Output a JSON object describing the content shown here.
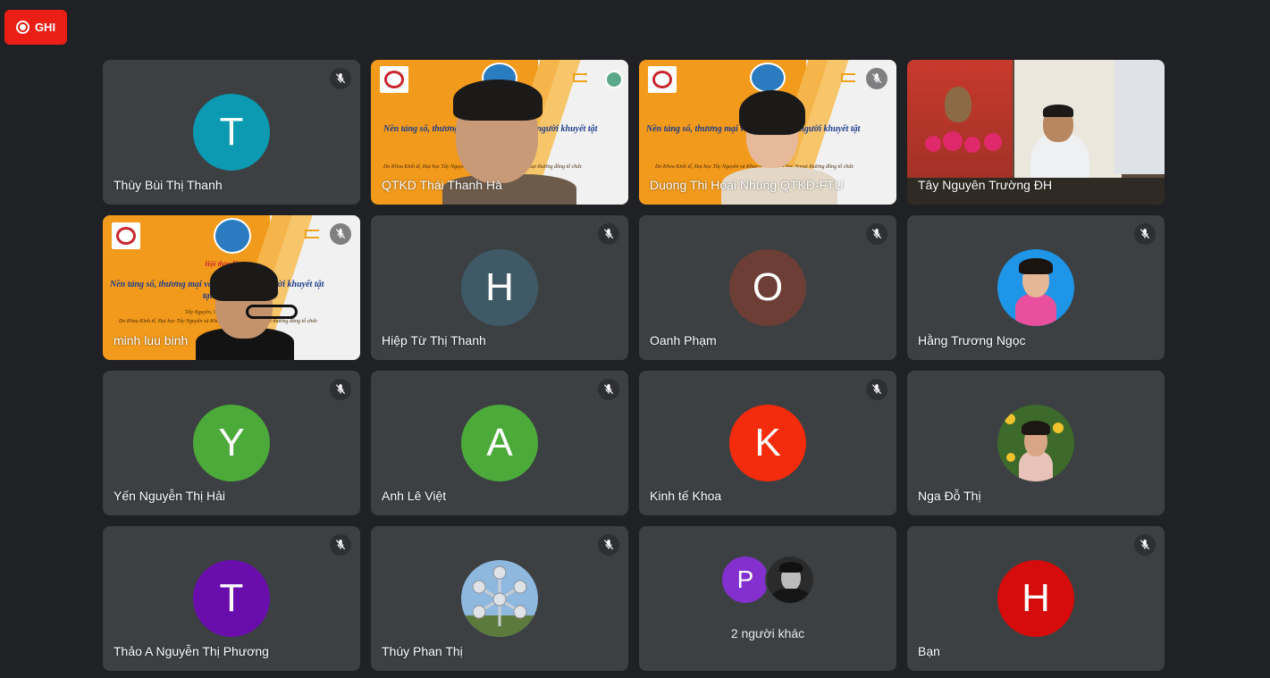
{
  "record": {
    "label": "GHI",
    "color": "#ea1e14",
    "icon": "record-icon"
  },
  "participants": [
    {
      "name": "Thùy Bùi Thị Thanh",
      "initial": "T",
      "color": "#0b9ab1",
      "muted": true
    },
    {
      "name": "QTKD Thái Thanh Hà",
      "video": "presentation",
      "muted": false
    },
    {
      "name": "Duong Thi Hoai Nhung QTKD-FTU",
      "video": "presentation",
      "muted": true
    },
    {
      "name": "Tây Nguyên Trường ĐH",
      "video": "room",
      "muted": false
    },
    {
      "name": "minh luu binh",
      "video": "presentation",
      "muted": true
    },
    {
      "name": "Hiệp Từ Thị Thanh",
      "initial": "H",
      "color": "#3f5a66",
      "muted": true
    },
    {
      "name": "Oanh Phạm",
      "initial": "O",
      "color": "#6d3e36",
      "muted": true
    },
    {
      "name": "Hằng Trương Ngọc",
      "photo": "portrait-blue",
      "muted": true
    },
    {
      "name": "Yến Nguyễn Thị Hải",
      "initial": "Y",
      "color": "#4caa3a",
      "muted": true
    },
    {
      "name": "Anh Lê Việt",
      "initial": "A",
      "color": "#4caa3a",
      "muted": true
    },
    {
      "name": "Kinh tế Khoa",
      "initial": "K",
      "color": "#f42b0c",
      "muted": true
    },
    {
      "name": "Nga Đỗ Thị",
      "photo": "portrait-garden",
      "muted": false
    },
    {
      "name": "Thảo A Nguyễn Thị Phương",
      "initial": "T",
      "color": "#6a0dad",
      "muted": true
    },
    {
      "name": "Thúy Phan Thị",
      "photo": "atomium",
      "muted": true
    },
    {
      "name": "",
      "others": true
    },
    {
      "name": "Bạn",
      "initial": "H",
      "color": "#d60b0b",
      "muted": true
    }
  ],
  "others_tile": {
    "label": "2 người khác",
    "initial": "P",
    "color": "#8430ce"
  },
  "slide": {
    "title_line1": "Nền tảng số, thương mại và việc làm cho người khuyết tật",
    "title_line2": "tại Việt Nam",
    "heading": "Hội thảo lần",
    "line_date": "Tây Nguyên, 07 tháng",
    "line_org": "Do Khoa Kinh tế, Đại học Tây Nguyên và Khoa QTKD, Đại học Ngoại thương đồng tổ chức"
  },
  "colors": {
    "background": "#202124",
    "tile": "#3c4043"
  }
}
